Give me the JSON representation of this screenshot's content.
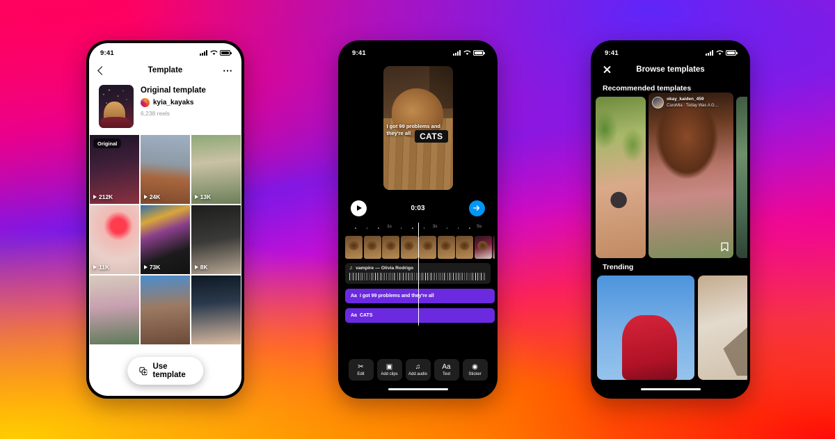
{
  "background": {
    "gradient_colors": [
      "#ff0a64",
      "#e0009a",
      "#7b18e8",
      "#c010d6",
      "#ff2a55",
      "#ff7a00",
      "#ffb400"
    ]
  },
  "phone1": {
    "status": {
      "time": "9:41",
      "signal_icon": "cellular-bars-icon",
      "wifi_icon": "wifi-icon",
      "battery_icon": "battery-icon"
    },
    "nav": {
      "back_icon": "chevron-left-icon",
      "title": "Template",
      "more_icon": "more-options-icon"
    },
    "template_header": {
      "thumbnail_name": "template-thumbnail",
      "title": "Original template",
      "username": "kyia_kayaks",
      "reel_count": "6,238 reels"
    },
    "grid": [
      {
        "views": "212K",
        "badge": "Original",
        "alt": "person with sparklers at night"
      },
      {
        "views": "24K",
        "badge": "",
        "alt": "person jumping on rooftop"
      },
      {
        "views": "13K",
        "badge": "",
        "alt": "person with long braids smiling"
      },
      {
        "views": "11K",
        "badge": "",
        "alt": "red neon flower light"
      },
      {
        "views": "73K",
        "badge": "",
        "alt": "person with braid by stained glass"
      },
      {
        "views": "8K",
        "badge": "",
        "alt": "black cat looking at phone"
      },
      {
        "views": "",
        "badge": "",
        "alt": "person with guitar on couch"
      },
      {
        "views": "",
        "badge": "",
        "alt": "person under blossom tree"
      },
      {
        "views": "",
        "badge": "",
        "alt": "person with hands up indoors"
      }
    ],
    "use_template_button": {
      "label": "Use template",
      "icon": "add-template-icon"
    }
  },
  "phone2": {
    "status": {
      "time": "9:41"
    },
    "preview": {
      "caption": "I got 99 problems and they're all",
      "sticker": "CATS",
      "alt": "dog lying on wooden floor"
    },
    "controls": {
      "play_icon": "play-icon",
      "time": "0:03",
      "next_icon": "arrow-right-icon",
      "next_color": "#0095f6"
    },
    "timeline": {
      "ruler_labels": [
        "1s",
        "3s",
        "5s"
      ],
      "audio": {
        "icon": "music-note-icon",
        "label": "vampire — Olivia Rodrigo"
      },
      "text_tracks": [
        {
          "prefix": "Aa",
          "label": "I got 99 problems and they're all"
        },
        {
          "prefix": "Aa",
          "label": "CATS"
        }
      ],
      "track_color": "#6b2ae0"
    },
    "toolbar": [
      {
        "icon": "edit-icon",
        "glyph": "✂",
        "label": "Edit"
      },
      {
        "icon": "add-clips-icon",
        "glyph": "◱",
        "label": "Add clips"
      },
      {
        "icon": "add-audio-icon",
        "glyph": "♫",
        "label": "Add audio"
      },
      {
        "icon": "text-icon",
        "glyph": "Aa",
        "label": "Text"
      },
      {
        "icon": "sticker-icon",
        "glyph": "◔",
        "label": "Sticker"
      }
    ]
  },
  "phone3": {
    "status": {
      "time": "9:41"
    },
    "nav": {
      "close_icon": "close-icon",
      "title": "Browse templates"
    },
    "recommended": {
      "section_title": "Recommended templates",
      "cards": [
        {
          "alt": "person with leaves and round sunglasses"
        },
        {
          "username": "okay_kaiden_459",
          "audio": "CaroMia · Today Was A G…",
          "alt": "person laughing covering face",
          "bookmark_icon": "bookmark-icon"
        },
        {
          "alt": "green foliage close up"
        }
      ]
    },
    "trending": {
      "section_title": "Trending",
      "cards": [
        {
          "alt": "person in red dress against blue sky"
        },
        {
          "alt": "shadow on beige wall"
        }
      ]
    }
  }
}
